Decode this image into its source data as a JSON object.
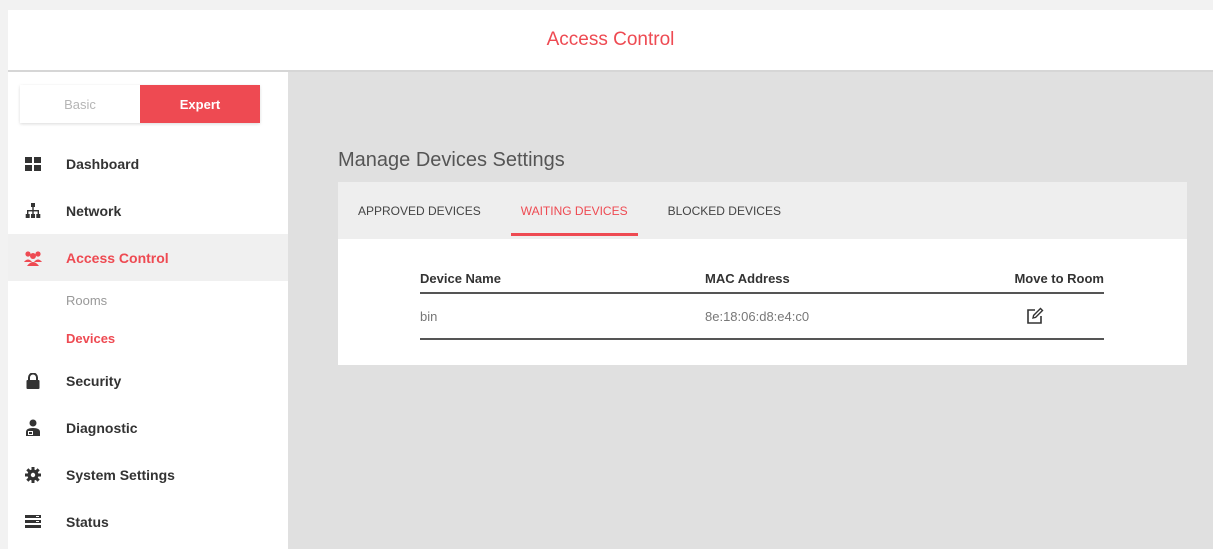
{
  "header": {
    "title": "Access Control"
  },
  "mode": {
    "basic_label": "Basic",
    "expert_label": "Expert",
    "selected": "Expert"
  },
  "sidebar": {
    "items": [
      {
        "label": "Dashboard",
        "icon": "dashboard-icon"
      },
      {
        "label": "Network",
        "icon": "network-icon"
      },
      {
        "label": "Access Control",
        "icon": "users-icon",
        "active": true,
        "children": [
          {
            "label": "Rooms"
          },
          {
            "label": "Devices",
            "active": true
          }
        ]
      },
      {
        "label": "Security",
        "icon": "lock-icon"
      },
      {
        "label": "Diagnostic",
        "icon": "diagnostic-icon"
      },
      {
        "label": "System Settings",
        "icon": "gear-icon"
      },
      {
        "label": "Status",
        "icon": "status-icon"
      }
    ]
  },
  "main": {
    "title": "Manage Devices Settings",
    "tabs": [
      {
        "label": "APPROVED DEVICES"
      },
      {
        "label": "WAITING DEVICES",
        "active": true
      },
      {
        "label": "BLOCKED DEVICES"
      }
    ],
    "table": {
      "columns": [
        "Device Name",
        "MAC Address",
        "Move to Room"
      ],
      "rows": [
        {
          "device_name": "bin",
          "mac_address": "8e:18:06:d8:e4:c0",
          "action_icon": "edit-icon"
        }
      ]
    }
  },
  "colors": {
    "accent": "#ee4a52",
    "main_bg": "#e0e0e0",
    "tab_bar_bg": "#eeeeee"
  }
}
